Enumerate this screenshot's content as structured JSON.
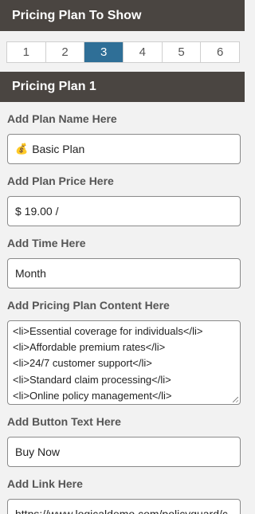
{
  "header": {
    "title": "Pricing Plan To Show"
  },
  "tabs": [
    {
      "label": "1",
      "active": false
    },
    {
      "label": "2",
      "active": false
    },
    {
      "label": "3",
      "active": true
    },
    {
      "label": "4",
      "active": false
    },
    {
      "label": "5",
      "active": false
    },
    {
      "label": "6",
      "active": false
    }
  ],
  "plan": {
    "title": "Pricing Plan 1",
    "name_label": "Add Plan Name Here",
    "name_emoji": "💰",
    "name_value": "Basic Plan",
    "price_label": "Add Plan Price Here",
    "price_value": "$ 19.00 /",
    "time_label": "Add Time Here",
    "time_value": "Month",
    "content_label": "Add Pricing Plan Content Here",
    "content_lines": [
      "<li>Essential coverage for individuals</li>",
      "<li>Affordable premium rates</li>",
      "<li>24/7 customer support</li>",
      "<li>Standard claim processing</li>",
      "<li>Online policy management</li>"
    ],
    "button_label": "Add Button Text Here",
    "button_value": "Buy Now",
    "link_label": "Add Link Here",
    "link_value": "https://www.logicaldemo.com/policyguard/c"
  },
  "colors": {
    "header_bg": "#4a4541",
    "active_tab": "#2f6f97",
    "panel_bg": "#f2f2f2"
  }
}
